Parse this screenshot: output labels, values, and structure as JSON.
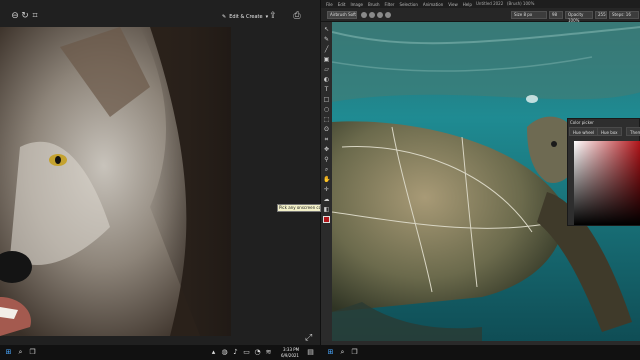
{
  "photos": {
    "edit_create": "Edit & Create",
    "icons": [
      "zoom-out-icon",
      "rotate-icon",
      "crop-icon",
      "share-icon",
      "print-icon",
      "more-icon",
      "zoom-fit-icon"
    ]
  },
  "editor": {
    "menu": [
      "File",
      "Edit",
      "Image",
      "Brush",
      "Filter",
      "Selection",
      "Animation",
      "View",
      "Help"
    ],
    "title": "Untitled 2022",
    "title_suffix": "(Brush) 100%",
    "brush_preset": "Airbrush Soft",
    "opacity_label": "Opacity 100%",
    "size_label": "Size 8 px",
    "size_value": "98",
    "flow_value": "255",
    "steps_label": "Steps: 16"
  },
  "picker": {
    "title": "Color picker",
    "tabs": [
      "Hue wheel",
      "Hue box",
      "Themes"
    ],
    "base_color": "#b2151a"
  },
  "tooltip": "Pick any onscreen color",
  "taskbar": {
    "time": "3:33 PM",
    "date": "6/9/2021"
  },
  "colors": {
    "accent": "#b2151a",
    "tooltip_bg": "#f3f1c9"
  }
}
